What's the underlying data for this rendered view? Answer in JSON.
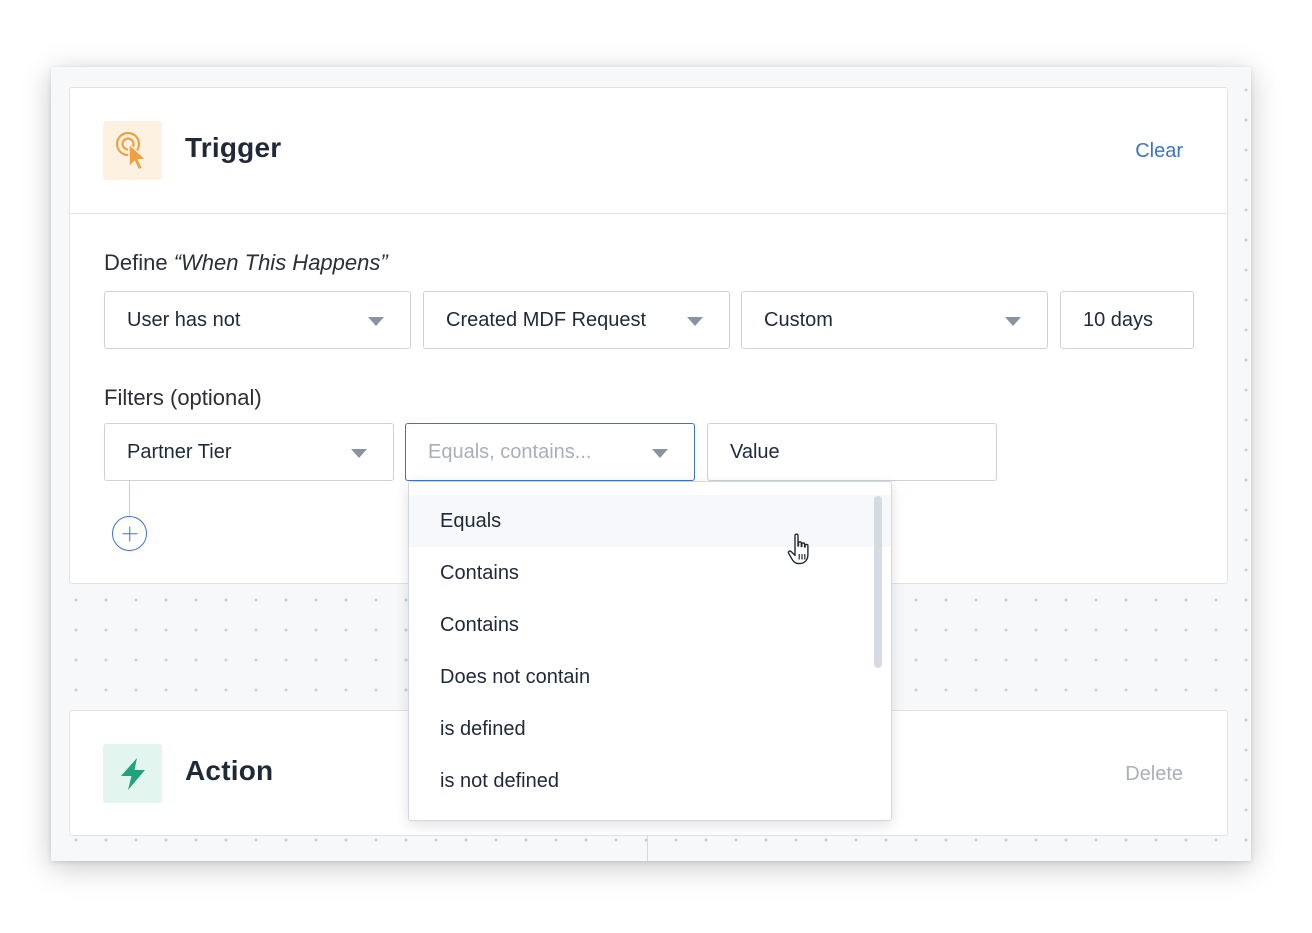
{
  "trigger": {
    "title": "Trigger",
    "clear_label": "Clear",
    "icon": "tap-pointer-icon",
    "accent": "#f0a040"
  },
  "define": {
    "label_prefix": "Define ",
    "label_quote": "“When This Happens”",
    "selects": {
      "user": "User has not",
      "event": "Created MDF Request",
      "period": "Custom",
      "days": "10 days"
    }
  },
  "filters": {
    "label": "Filters (optional)",
    "field": "Partner Tier",
    "operator_placeholder": "Equals, contains...",
    "value_placeholder": "Value"
  },
  "operator_options": [
    "Equals",
    "Contains",
    "Contains",
    "Does not contain",
    "is defined",
    "is not defined"
  ],
  "action": {
    "title": "Action",
    "delete_label": "Delete",
    "icon": "lightning-bolt-icon",
    "accent": "#1fa37a"
  },
  "colors": {
    "primary": "#3b73c9",
    "border": "#cdd2d9",
    "canvas": "#f7f8fa"
  }
}
